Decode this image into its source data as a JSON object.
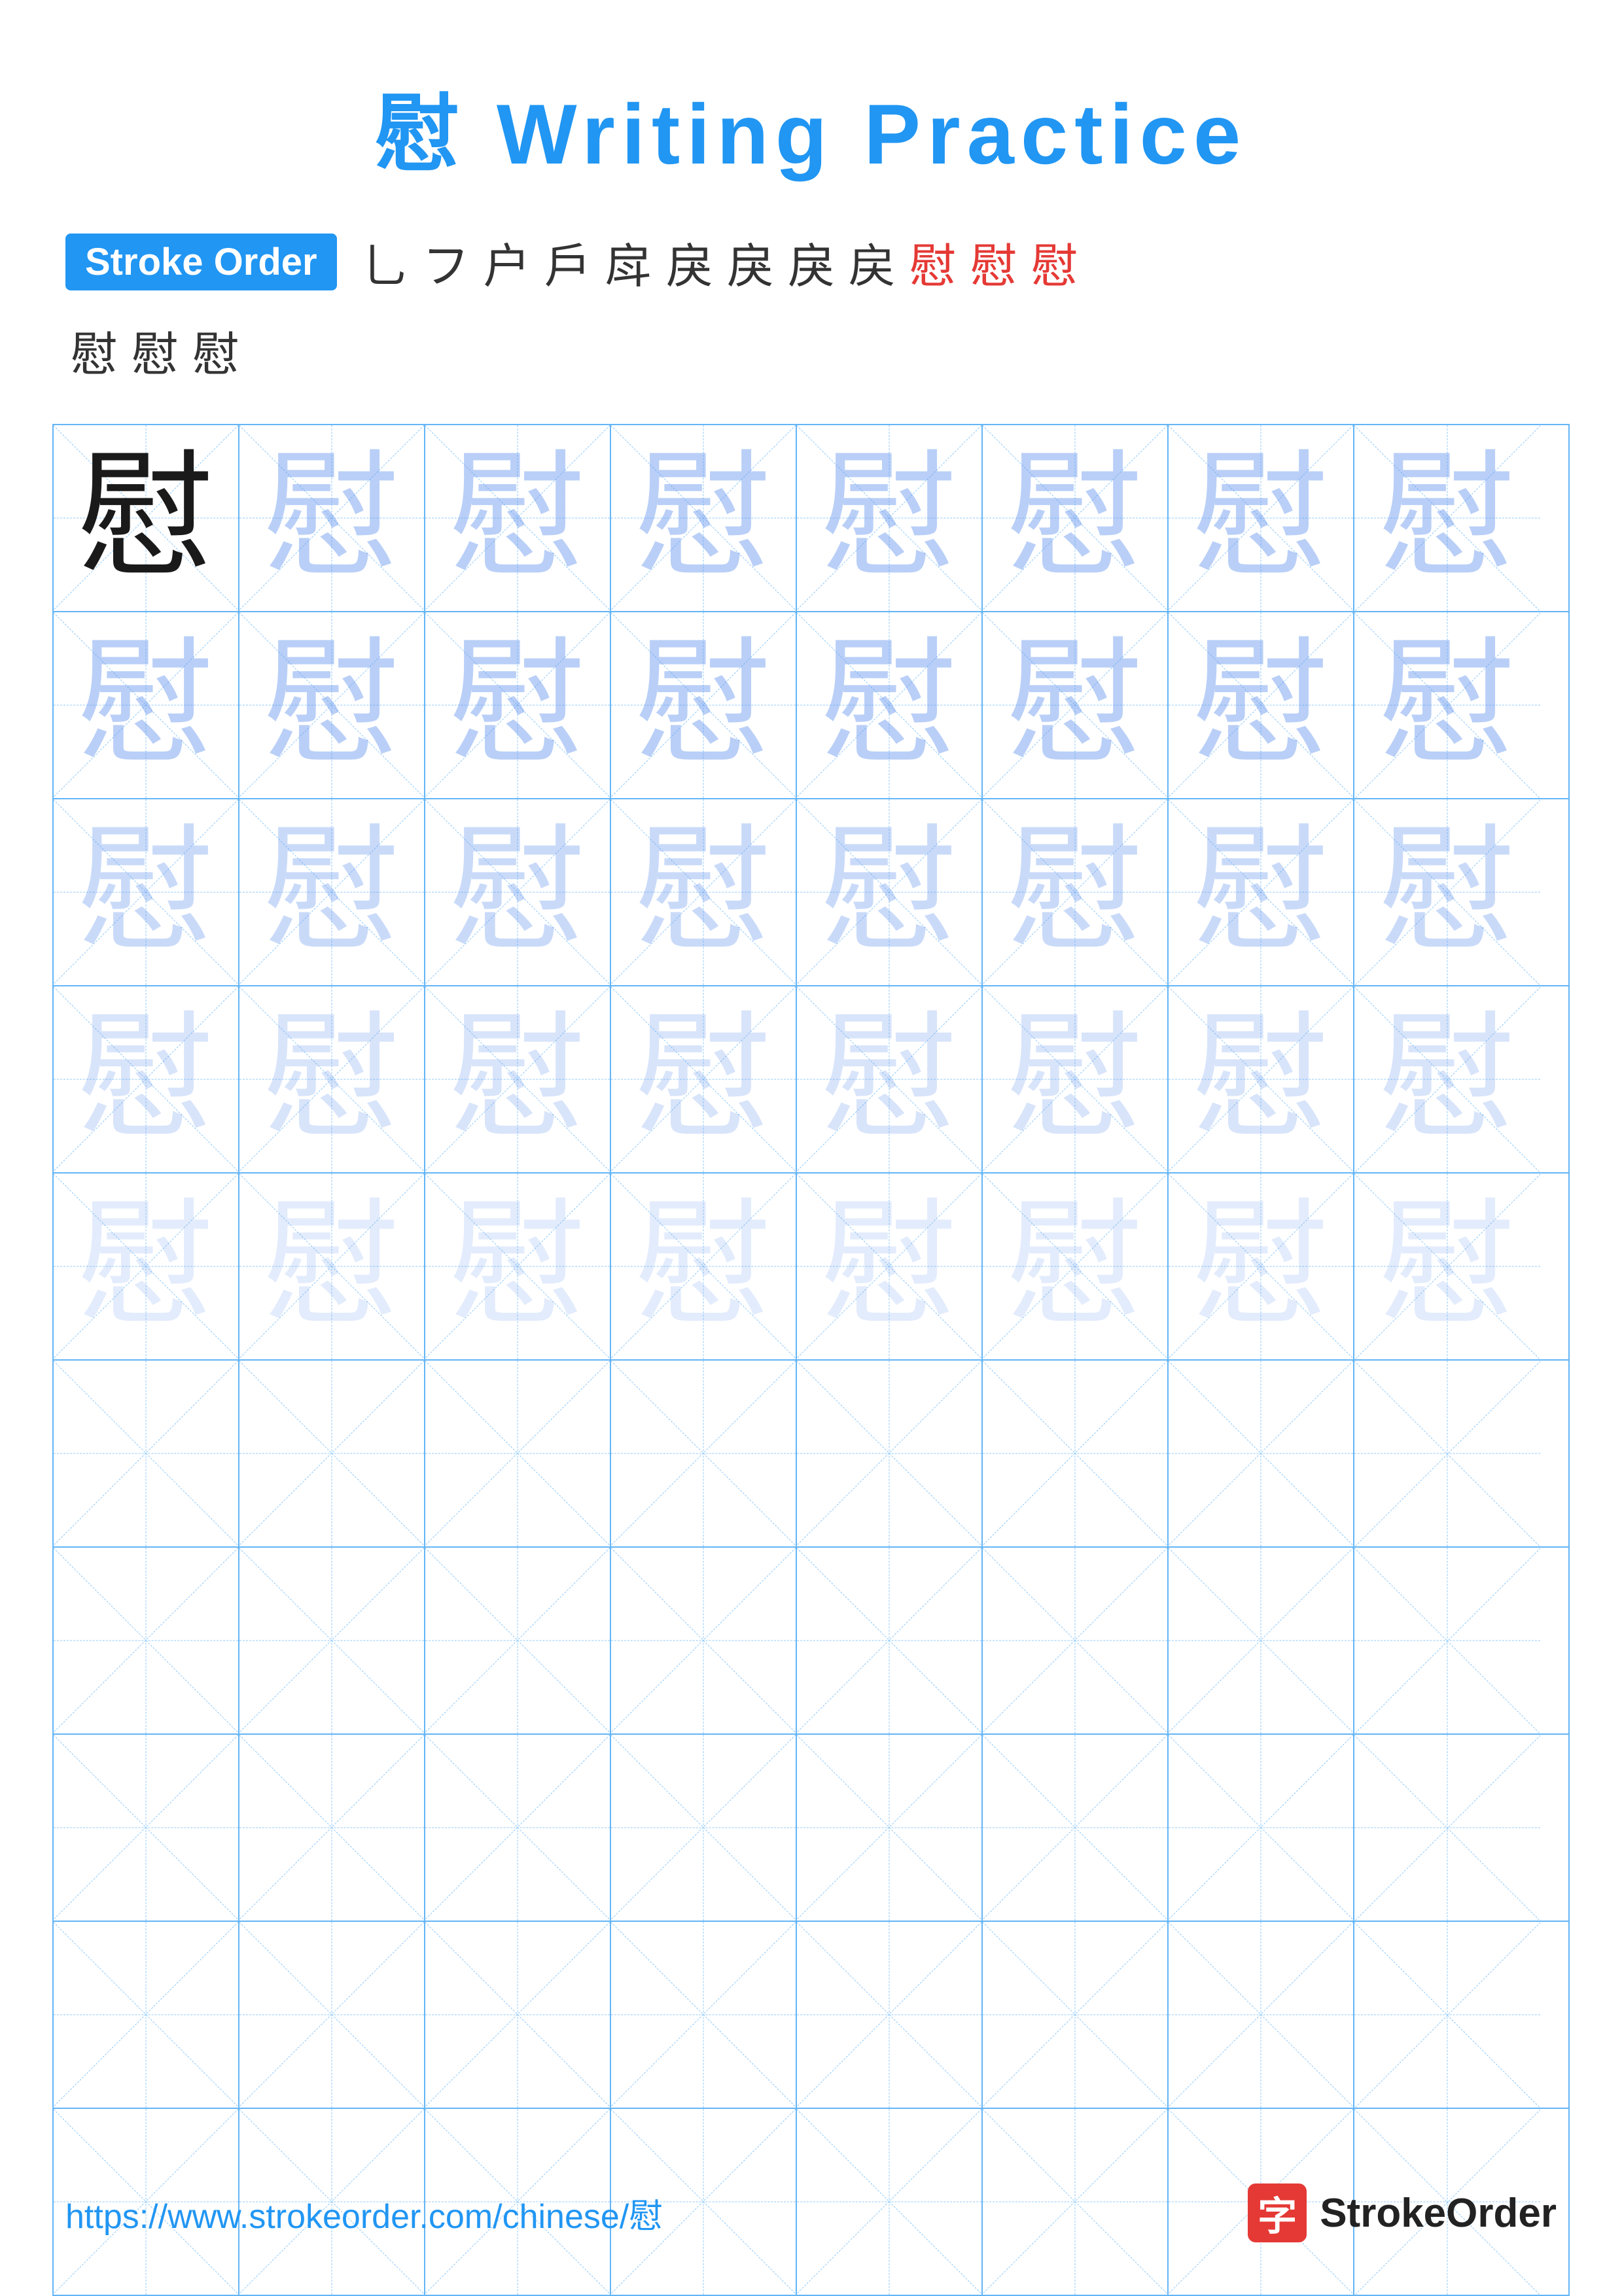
{
  "title": {
    "char": "慰",
    "text": " Writing Practice",
    "color": "#2196F3"
  },
  "stroke_order": {
    "badge_label": "Stroke Order",
    "strokes_row1": [
      "⺃",
      "フ",
      "户",
      "戶",
      "戽",
      "戾",
      "戾",
      "戾",
      "戻",
      "慰",
      "慰",
      "慰"
    ],
    "strokes_row2": [
      "慰",
      "慰",
      "慰"
    ],
    "red_indices_row1": [
      9,
      10,
      11
    ],
    "red_indices_row2": [
      0
    ]
  },
  "grid": {
    "char": "慰",
    "rows": 10,
    "cols": 8,
    "practice_rows": [
      {
        "type": "dark",
        "count": 1,
        "rest_opacity": "light1"
      },
      {
        "type": "light1",
        "count": 8
      },
      {
        "type": "light2",
        "count": 8
      },
      {
        "type": "light3",
        "count": 8
      },
      {
        "type": "light4",
        "count": 8
      },
      {
        "type": "empty"
      },
      {
        "type": "empty"
      },
      {
        "type": "empty"
      },
      {
        "type": "empty"
      },
      {
        "type": "empty"
      }
    ]
  },
  "footer": {
    "url": "https://www.strokeorder.com/chinese/慰",
    "brand_char": "字",
    "brand_name": "StrokeOrder"
  }
}
